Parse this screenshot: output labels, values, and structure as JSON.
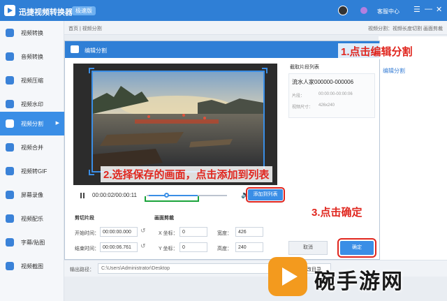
{
  "app": {
    "name": "迅捷视频转换器",
    "edition": "极速版",
    "service": "客服中心",
    "controls": [
      "☰",
      "—",
      "✕"
    ]
  },
  "sidebar": {
    "items": [
      {
        "label": "视频转换"
      },
      {
        "label": "音频转换"
      },
      {
        "label": "视频压缩"
      },
      {
        "label": "视频水印"
      },
      {
        "label": "视频分割",
        "active": true
      },
      {
        "label": "视频合并"
      },
      {
        "label": "视频转GIF"
      },
      {
        "label": "屏幕录像"
      },
      {
        "label": "视频配乐"
      },
      {
        "label": "字幕/贴图"
      },
      {
        "label": "视频截图"
      }
    ]
  },
  "breadcrumb": {
    "left": "首页 | 视频分割",
    "right": "视频分割：视频长度切割 画面剪裁"
  },
  "right_panel": {
    "edit_label": "编辑分割"
  },
  "dialog": {
    "title": "编辑分割",
    "player": {
      "time": "00:00:02/00:00:11",
      "add_label": "添加到列表",
      "progress": 0.25
    },
    "trim": {
      "title": "剪切片段",
      "start_label": "开始时间：",
      "start_value": "00:00:00.000",
      "end_label": "结束时间：",
      "end_value": "00:00:06.761"
    },
    "crop": {
      "title": "画面剪裁",
      "x_label": "X 坐标：",
      "x_value": "0",
      "y_label": "Y 坐标：",
      "y_value": "0",
      "w_label": "宽度：",
      "w_value": "426",
      "h_label": "高度：",
      "h_value": "240"
    },
    "list": {
      "title": "截取片段列表",
      "item": {
        "name": "流水人家000000-000006",
        "seg_key": "片段：",
        "seg_value": "00:00:00-00:00:06",
        "size_key": "视频尺寸：",
        "size_value": "426x240"
      }
    },
    "cancel_label": "取消",
    "ok_label": "确定"
  },
  "bottom": {
    "label": "输出路径：",
    "path": "C:\\Users\\Administrator\\Desktop",
    "change_label": "更改目录"
  },
  "callouts": {
    "step1": "1.点击编辑分割",
    "step2": "2.选择保存的画面，点击添加到列表",
    "step3": "3.点击确定"
  },
  "watermark": {
    "text": "碗手游网"
  },
  "colors": {
    "brand": "#2f7fd6",
    "accent": "#3a8ee6",
    "callout": "#e0261e",
    "highlight": "#1aa33b"
  }
}
